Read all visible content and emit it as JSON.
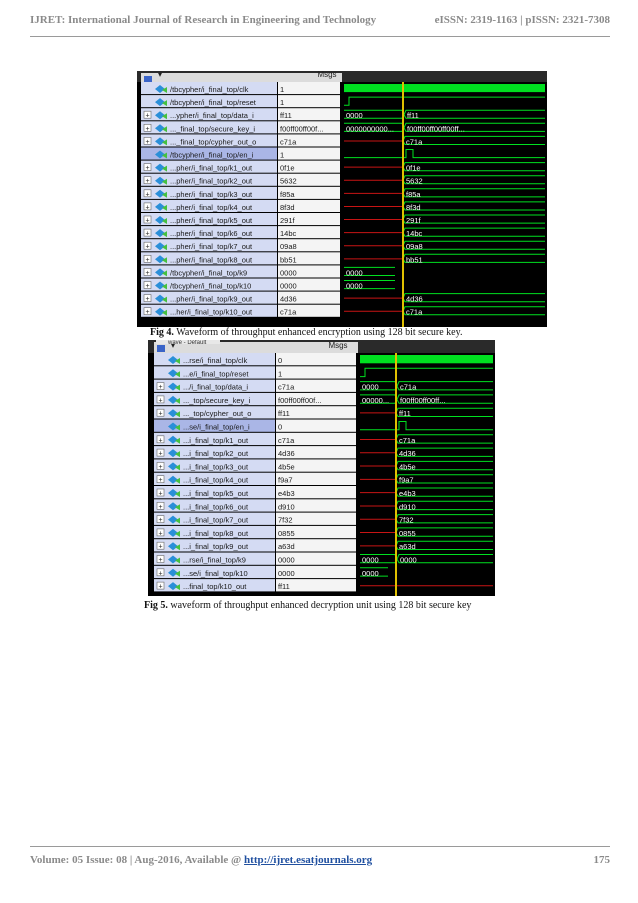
{
  "header": {
    "journal": "IJRET: International Journal of Research in Engineering and Technology",
    "issn": "eISSN: 2319-1163 | pISSN: 2321-7308"
  },
  "footer": {
    "volume": "Volume: 05 Issue: 08 | Aug-2016, Available @ ",
    "url": "http://ijret.esatjournals.org",
    "page": "175"
  },
  "colors": {
    "green": "#00e020",
    "red": "#c81414",
    "cursor": "#e0c000",
    "panel_bg": "#dcdcdc",
    "name_bg": "#d4dbf3",
    "selected": "#aab6e6"
  },
  "fig4": {
    "toolbar": "",
    "msgs": "Msgs",
    "caption_label": "Fig 4.",
    "caption_text": " Waveform of throughput enhanced encryption using 128 bit secure key.",
    "signals": [
      {
        "name": "/tbcypher/i_final_top/clk",
        "value": "1",
        "expand": false,
        "wave": "clk",
        "v1": "",
        "v2": ""
      },
      {
        "name": "/tbcypher/i_final_top/reset",
        "value": "1",
        "expand": false,
        "wave": "reset",
        "v1": "",
        "v2": ""
      },
      {
        "name": "...ypher/i_final_top/data_i",
        "value": "ff11",
        "expand": true,
        "wave": "bus",
        "v1": "0000",
        "v2": "ff11"
      },
      {
        "name": "..._final_top/secure_key_i",
        "value": "f00ff00ff00f...",
        "expand": true,
        "wave": "bus",
        "v1": "0000000000...",
        "v2": "f00ff00ff00ff00ff..."
      },
      {
        "name": "..._final_top/cypher_out_o",
        "value": "c71a",
        "expand": true,
        "wave": "late",
        "v1": "",
        "v2": "c71a"
      },
      {
        "name": "/tbcypher/i_final_top/en_i",
        "value": "1",
        "expand": false,
        "wave": "en",
        "v1": "",
        "v2": ""
      },
      {
        "name": "...pher/i_final_top/k1_out",
        "value": "0f1e",
        "expand": true,
        "wave": "late",
        "v1": "",
        "v2": "0f1e"
      },
      {
        "name": "...pher/i_final_top/k2_out",
        "value": "5632",
        "expand": true,
        "wave": "late",
        "v1": "",
        "v2": "5632"
      },
      {
        "name": "...pher/i_final_top/k3_out",
        "value": "f85a",
        "expand": true,
        "wave": "late",
        "v1": "",
        "v2": "f85a"
      },
      {
        "name": "...pher/i_final_top/k4_out",
        "value": "8f3d",
        "expand": true,
        "wave": "late",
        "v1": "",
        "v2": "8f3d"
      },
      {
        "name": "...pher/i_final_top/k5_out",
        "value": "291f",
        "expand": true,
        "wave": "late",
        "v1": "",
        "v2": "291f"
      },
      {
        "name": "...pher/i_final_top/k6_out",
        "value": "14bc",
        "expand": true,
        "wave": "late",
        "v1": "",
        "v2": "14bc"
      },
      {
        "name": "...pher/i_final_top/k7_out",
        "value": "09a8",
        "expand": true,
        "wave": "late",
        "v1": "",
        "v2": "09a8"
      },
      {
        "name": "...pher/i_final_top/k8_out",
        "value": "bb51",
        "expand": true,
        "wave": "late",
        "v1": "",
        "v2": "bb51"
      },
      {
        "name": "/tbcypher/i_final_top/k9",
        "value": "0000",
        "expand": true,
        "wave": "short",
        "v1": "0000",
        "v2": ""
      },
      {
        "name": "/tbcypher/i_final_top/k10",
        "value": "0000",
        "expand": true,
        "wave": "short",
        "v1": "0000",
        "v2": ""
      },
      {
        "name": "...pher/i_final_top/k9_out",
        "value": "4d36",
        "expand": true,
        "wave": "late",
        "v1": "",
        "v2": "4d36"
      },
      {
        "name": "...her/i_final_top/k10_out",
        "value": "c71a",
        "expand": true,
        "wave": "late",
        "v1": "",
        "v2": "c71a"
      }
    ]
  },
  "fig5": {
    "toolbar": "wave - Default",
    "msgs": "Msgs",
    "caption_label": "Fig 5.",
    "caption_text": " waveform of throughput enhanced decryption unit using 128 bit secure key",
    "signals": [
      {
        "name": "...rse/i_final_top/clk",
        "value": "0",
        "expand": false,
        "wave": "clk",
        "v1": "",
        "v2": ""
      },
      {
        "name": "...e/i_final_top/reset",
        "value": "1",
        "expand": false,
        "wave": "reset",
        "v1": "",
        "v2": ""
      },
      {
        "name": ".../i_final_top/data_i",
        "value": "c71a",
        "expand": true,
        "wave": "bus",
        "v1": "0000",
        "v2": "c71a"
      },
      {
        "name": "..._top/secure_key_i",
        "value": "f00ff00ff00f...",
        "expand": true,
        "wave": "bus",
        "v1": "00000...",
        "v2": "f00ff00ff00ff..."
      },
      {
        "name": "..._top/cypher_out_o",
        "value": "ff11",
        "expand": true,
        "wave": "late",
        "v1": "",
        "v2": "ff11"
      },
      {
        "name": "...se/i_final_top/en_i",
        "value": "0",
        "expand": false,
        "wave": "en",
        "v1": "",
        "v2": ""
      },
      {
        "name": "...i_final_top/k1_out",
        "value": "c71a",
        "expand": true,
        "wave": "late",
        "v1": "",
        "v2": "c71a"
      },
      {
        "name": "...i_final_top/k2_out",
        "value": "4d36",
        "expand": true,
        "wave": "late",
        "v1": "",
        "v2": "4d36"
      },
      {
        "name": "...i_final_top/k3_out",
        "value": "4b5e",
        "expand": true,
        "wave": "late",
        "v1": "",
        "v2": "4b5e"
      },
      {
        "name": "...i_final_top/k4_out",
        "value": "f9a7",
        "expand": true,
        "wave": "late",
        "v1": "",
        "v2": "f9a7"
      },
      {
        "name": "...i_final_top/k5_out",
        "value": "e4b3",
        "expand": true,
        "wave": "late",
        "v1": "",
        "v2": "e4b3"
      },
      {
        "name": "...i_final_top/k6_out",
        "value": "d910",
        "expand": true,
        "wave": "late",
        "v1": "",
        "v2": "d910"
      },
      {
        "name": "...i_final_top/k7_out",
        "value": "7f32",
        "expand": true,
        "wave": "late",
        "v1": "",
        "v2": "7f32"
      },
      {
        "name": "...i_final_top/k8_out",
        "value": "0855",
        "expand": true,
        "wave": "late",
        "v1": "",
        "v2": "0855"
      },
      {
        "name": "...i_final_top/k9_out",
        "value": "a63d",
        "expand": true,
        "wave": "late",
        "v1": "",
        "v2": "a63d"
      },
      {
        "name": "...rse/i_final_top/k9",
        "value": "0000",
        "expand": true,
        "wave": "bus",
        "v1": "0000",
        "v2": "0000"
      },
      {
        "name": "...se/i_final_top/k10",
        "value": "0000",
        "expand": true,
        "wave": "short",
        "v1": "0000",
        "v2": ""
      },
      {
        "name": "...final_top/k10_out",
        "value": "ff11",
        "expand": true,
        "wave": "cut",
        "v1": "",
        "v2": ""
      }
    ]
  }
}
